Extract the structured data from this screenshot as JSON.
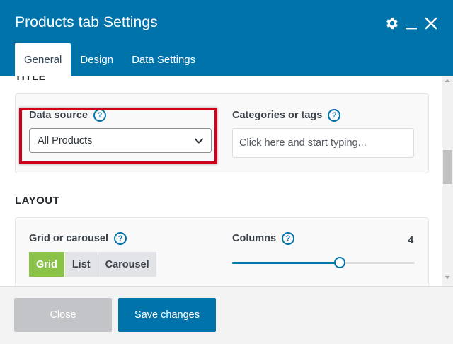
{
  "modal": {
    "title": "Products tab Settings",
    "icons": {
      "settings": "gear-icon",
      "minimize": "minimize-icon",
      "close": "close-icon"
    }
  },
  "tabs": [
    {
      "label": "General",
      "active": true
    },
    {
      "label": "Design",
      "active": false
    },
    {
      "label": "Data Settings",
      "active": false
    }
  ],
  "sections": {
    "title_section": {
      "heading": "TITLE"
    },
    "layout_section": {
      "heading": "LAYOUT"
    }
  },
  "fields": {
    "data_source": {
      "label": "Data source",
      "help": "?",
      "selected": "All Products"
    },
    "categories": {
      "label": "Categories or tags",
      "help": "?",
      "value": "",
      "placeholder": "Click here and start typing..."
    },
    "grid_or_carousel": {
      "label": "Grid or carousel",
      "help": "?",
      "options": [
        {
          "label": "Grid",
          "active": true
        },
        {
          "label": "List",
          "active": false
        },
        {
          "label": "Carousel",
          "active": false
        }
      ]
    },
    "columns": {
      "label": "Columns",
      "help": "?",
      "value": "4",
      "level_fraction": 0.59
    }
  },
  "footer": {
    "close_label": "Close",
    "save_label": "Save changes"
  },
  "colors": {
    "header": "#0073aa",
    "active_segment": "#8bc34a",
    "highlight_box": "#d0021b",
    "disabled_button": "#c3c4c7",
    "primary_button": "#0073aa"
  }
}
